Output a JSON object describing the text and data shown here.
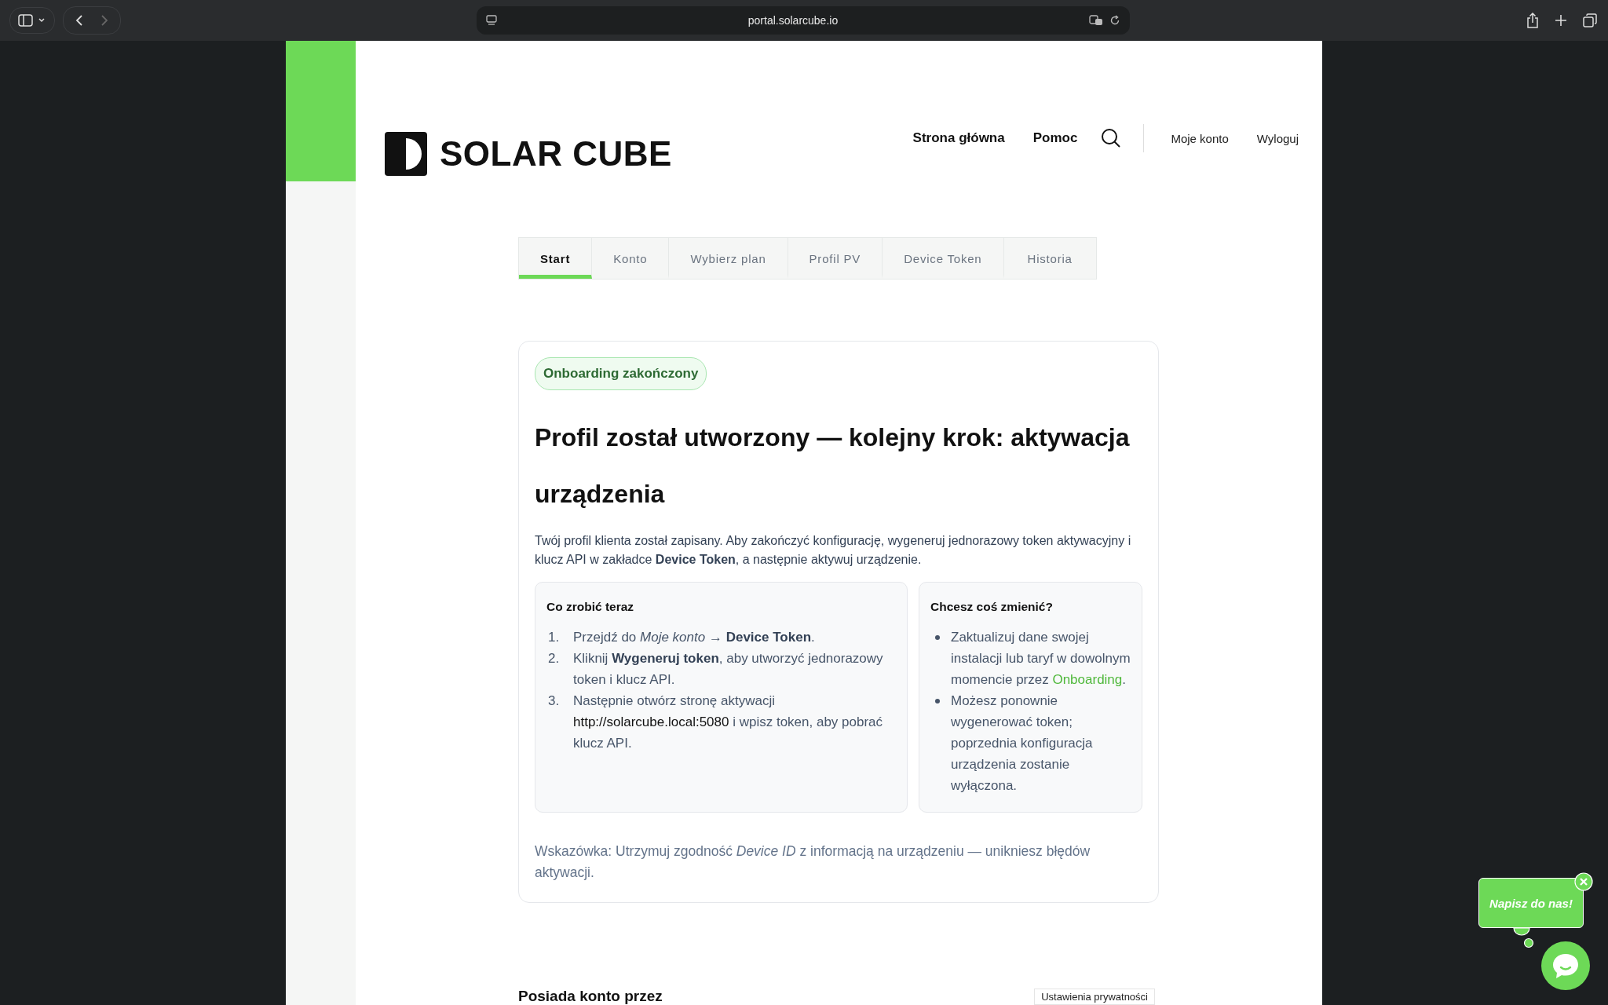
{
  "browser": {
    "url": "portal.solarcube.io"
  },
  "header": {
    "logo": "SOLAR CUBE",
    "nav": [
      "Strona główna",
      "Pomoc"
    ],
    "account_links": [
      "Moje konto",
      "Wyloguj"
    ]
  },
  "tabs": [
    {
      "label": "Start",
      "selected": true
    },
    {
      "label": "Konto",
      "selected": false
    },
    {
      "label": "Wybierz plan",
      "selected": false
    },
    {
      "label": "Profil PV",
      "selected": false
    },
    {
      "label": "Device Token",
      "selected": false
    },
    {
      "label": "Historia",
      "selected": false
    }
  ],
  "card": {
    "badge": "Onboarding zakończony",
    "title": "Profil został utworzony — kolejny krok: aktywacja urządzenia",
    "intro": "Twój profil klienta został zapisany. Aby zakończyć konfigurację, wygeneruj jednorazowy token aktywacyjny i klucz API w zakładce **Device Token**, a następnie aktywuj urządzenie.",
    "steps": {
      "title": "Co zrobić teraz",
      "items": [
        {
          "number": "1.",
          "text": "Przejdź do *Moje konto* → **Device Token**."
        },
        {
          "number": "2.",
          "text": "Kliknij **Wygeneruj token**, aby utworzyć jednorazowy token i klucz API."
        },
        {
          "number": "3.",
          "text": "Następnie otwórz stronę aktywacji ",
          "link": "http://solarcube.local:5080",
          "after": " i wpisz token, aby pobrać klucz API."
        }
      ]
    },
    "changes": {
      "title": "Chcesz coś zmienić?",
      "items": [
        {
          "text": "Zaktualizuj dane swojej instalacji lub taryf w dowolnym momencie przez ",
          "link": "Onboarding",
          "after": "."
        },
        {
          "text": "Możesz ponownie wygenerować token; poprzednia konfiguracja urządzenia zostanie wyłączona."
        }
      ]
    },
    "hint": "Wskazówka: Utrzymuj zgodność *Device ID* z informacją na urządzeniu — unikniesz błędów aktywacji."
  },
  "section_heading": "Posiada konto przez",
  "privacy_button": "Ustawienia prywatności",
  "chat": {
    "bubble": "Napisz do nas!"
  }
}
